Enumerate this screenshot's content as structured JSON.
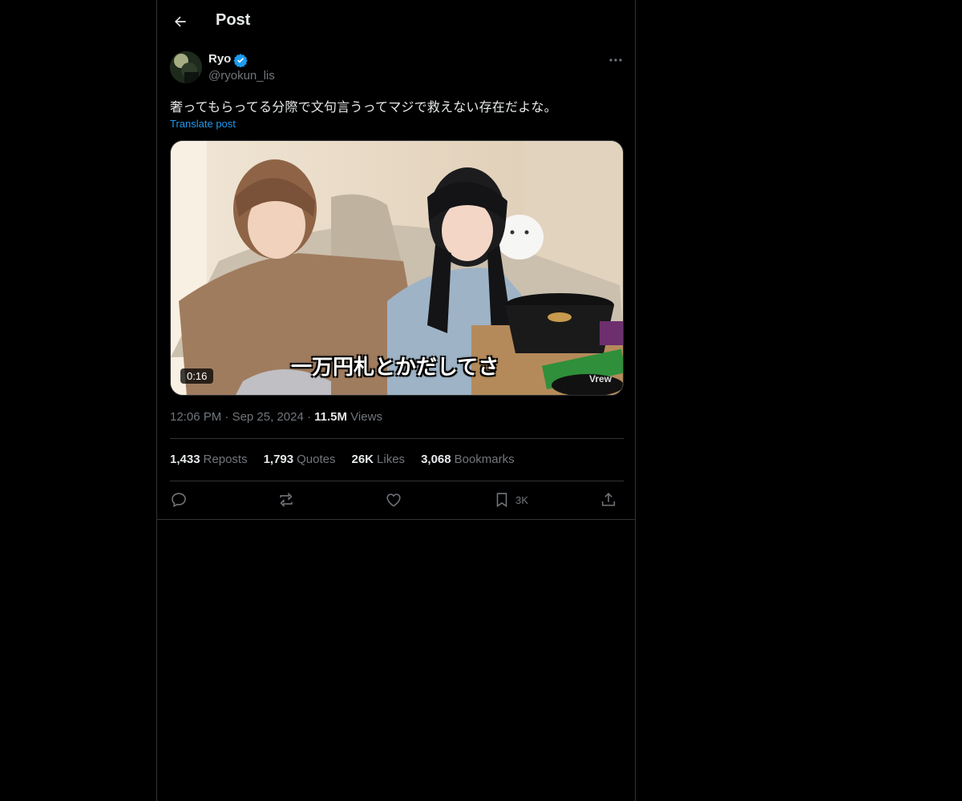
{
  "header": {
    "title": "Post"
  },
  "author": {
    "name": "Ryo",
    "handle": "@ryokun_lis"
  },
  "post": {
    "text": "奢ってもらってる分際で文句言うってマジで救えない存在だよな。",
    "translate_label": "Translate post"
  },
  "media": {
    "duration": "0:16",
    "subtitle": "一万円札とかだしてさ",
    "watermark": "Vrew"
  },
  "meta": {
    "time": "12:06 PM",
    "date": "Sep 25, 2024",
    "views_count": "11.5M",
    "views_label": "Views"
  },
  "stats": {
    "reposts_count": "1,433",
    "reposts_label": "Reposts",
    "quotes_count": "1,793",
    "quotes_label": "Quotes",
    "likes_count": "26K",
    "likes_label": "Likes",
    "bookmarks_count": "3,068",
    "bookmarks_label": "Bookmarks"
  },
  "actions": {
    "bookmark_count": "3K"
  },
  "icons": {
    "back": "arrow-left-icon",
    "verified": "verified-badge-icon",
    "more": "more-dots-icon",
    "reply": "reply-icon",
    "repost": "repost-icon",
    "like": "heart-icon",
    "bookmark": "bookmark-icon",
    "share": "share-icon"
  },
  "colors": {
    "accent": "#1d9bf0",
    "background": "#000000",
    "text": "#e7e9ea",
    "muted": "#71767b",
    "border": "#2f3336"
  }
}
